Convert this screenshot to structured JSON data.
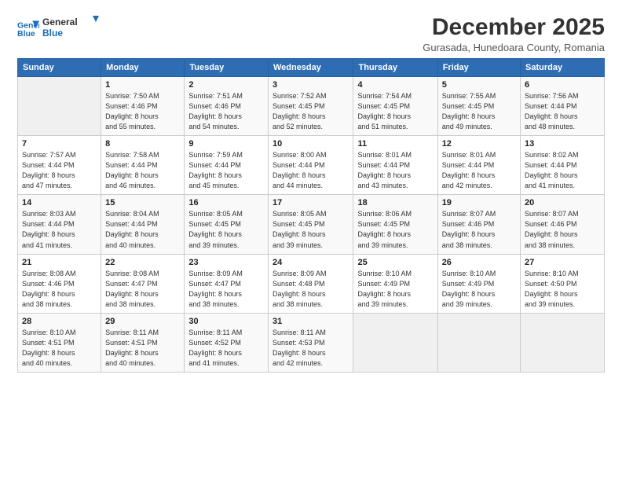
{
  "logo": {
    "line1": "General",
    "line2": "Blue"
  },
  "title": "December 2025",
  "subtitle": "Gurasada, Hunedoara County, Romania",
  "header_days": [
    "Sunday",
    "Monday",
    "Tuesday",
    "Wednesday",
    "Thursday",
    "Friday",
    "Saturday"
  ],
  "weeks": [
    [
      {
        "day": "",
        "info": ""
      },
      {
        "day": "1",
        "info": "Sunrise: 7:50 AM\nSunset: 4:46 PM\nDaylight: 8 hours\nand 55 minutes."
      },
      {
        "day": "2",
        "info": "Sunrise: 7:51 AM\nSunset: 4:46 PM\nDaylight: 8 hours\nand 54 minutes."
      },
      {
        "day": "3",
        "info": "Sunrise: 7:52 AM\nSunset: 4:45 PM\nDaylight: 8 hours\nand 52 minutes."
      },
      {
        "day": "4",
        "info": "Sunrise: 7:54 AM\nSunset: 4:45 PM\nDaylight: 8 hours\nand 51 minutes."
      },
      {
        "day": "5",
        "info": "Sunrise: 7:55 AM\nSunset: 4:45 PM\nDaylight: 8 hours\nand 49 minutes."
      },
      {
        "day": "6",
        "info": "Sunrise: 7:56 AM\nSunset: 4:44 PM\nDaylight: 8 hours\nand 48 minutes."
      }
    ],
    [
      {
        "day": "7",
        "info": "Sunrise: 7:57 AM\nSunset: 4:44 PM\nDaylight: 8 hours\nand 47 minutes."
      },
      {
        "day": "8",
        "info": "Sunrise: 7:58 AM\nSunset: 4:44 PM\nDaylight: 8 hours\nand 46 minutes."
      },
      {
        "day": "9",
        "info": "Sunrise: 7:59 AM\nSunset: 4:44 PM\nDaylight: 8 hours\nand 45 minutes."
      },
      {
        "day": "10",
        "info": "Sunrise: 8:00 AM\nSunset: 4:44 PM\nDaylight: 8 hours\nand 44 minutes."
      },
      {
        "day": "11",
        "info": "Sunrise: 8:01 AM\nSunset: 4:44 PM\nDaylight: 8 hours\nand 43 minutes."
      },
      {
        "day": "12",
        "info": "Sunrise: 8:01 AM\nSunset: 4:44 PM\nDaylight: 8 hours\nand 42 minutes."
      },
      {
        "day": "13",
        "info": "Sunrise: 8:02 AM\nSunset: 4:44 PM\nDaylight: 8 hours\nand 41 minutes."
      }
    ],
    [
      {
        "day": "14",
        "info": "Sunrise: 8:03 AM\nSunset: 4:44 PM\nDaylight: 8 hours\nand 41 minutes."
      },
      {
        "day": "15",
        "info": "Sunrise: 8:04 AM\nSunset: 4:44 PM\nDaylight: 8 hours\nand 40 minutes."
      },
      {
        "day": "16",
        "info": "Sunrise: 8:05 AM\nSunset: 4:45 PM\nDaylight: 8 hours\nand 39 minutes."
      },
      {
        "day": "17",
        "info": "Sunrise: 8:05 AM\nSunset: 4:45 PM\nDaylight: 8 hours\nand 39 minutes."
      },
      {
        "day": "18",
        "info": "Sunrise: 8:06 AM\nSunset: 4:45 PM\nDaylight: 8 hours\nand 39 minutes."
      },
      {
        "day": "19",
        "info": "Sunrise: 8:07 AM\nSunset: 4:46 PM\nDaylight: 8 hours\nand 38 minutes."
      },
      {
        "day": "20",
        "info": "Sunrise: 8:07 AM\nSunset: 4:46 PM\nDaylight: 8 hours\nand 38 minutes."
      }
    ],
    [
      {
        "day": "21",
        "info": "Sunrise: 8:08 AM\nSunset: 4:46 PM\nDaylight: 8 hours\nand 38 minutes."
      },
      {
        "day": "22",
        "info": "Sunrise: 8:08 AM\nSunset: 4:47 PM\nDaylight: 8 hours\nand 38 minutes."
      },
      {
        "day": "23",
        "info": "Sunrise: 8:09 AM\nSunset: 4:47 PM\nDaylight: 8 hours\nand 38 minutes."
      },
      {
        "day": "24",
        "info": "Sunrise: 8:09 AM\nSunset: 4:48 PM\nDaylight: 8 hours\nand 38 minutes."
      },
      {
        "day": "25",
        "info": "Sunrise: 8:10 AM\nSunset: 4:49 PM\nDaylight: 8 hours\nand 39 minutes."
      },
      {
        "day": "26",
        "info": "Sunrise: 8:10 AM\nSunset: 4:49 PM\nDaylight: 8 hours\nand 39 minutes."
      },
      {
        "day": "27",
        "info": "Sunrise: 8:10 AM\nSunset: 4:50 PM\nDaylight: 8 hours\nand 39 minutes."
      }
    ],
    [
      {
        "day": "28",
        "info": "Sunrise: 8:10 AM\nSunset: 4:51 PM\nDaylight: 8 hours\nand 40 minutes."
      },
      {
        "day": "29",
        "info": "Sunrise: 8:11 AM\nSunset: 4:51 PM\nDaylight: 8 hours\nand 40 minutes."
      },
      {
        "day": "30",
        "info": "Sunrise: 8:11 AM\nSunset: 4:52 PM\nDaylight: 8 hours\nand 41 minutes."
      },
      {
        "day": "31",
        "info": "Sunrise: 8:11 AM\nSunset: 4:53 PM\nDaylight: 8 hours\nand 42 minutes."
      },
      {
        "day": "",
        "info": ""
      },
      {
        "day": "",
        "info": ""
      },
      {
        "day": "",
        "info": ""
      }
    ]
  ]
}
